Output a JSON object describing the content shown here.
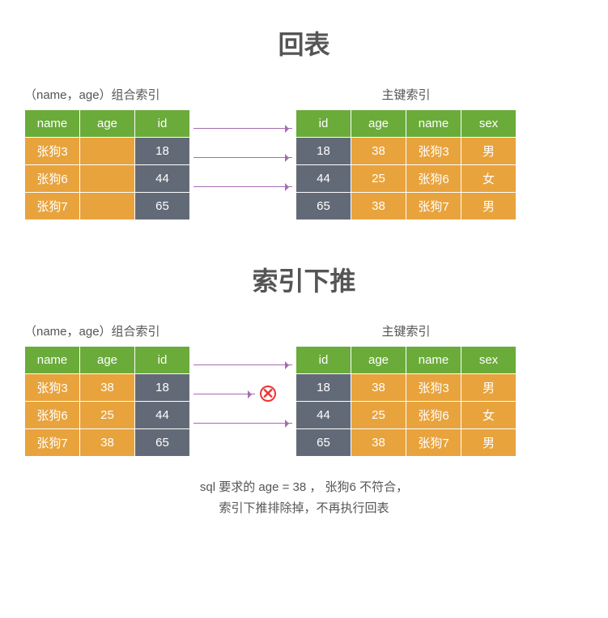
{
  "section1": {
    "title": "回表",
    "left_caption": "（name，age）组合索引",
    "right_caption": "主键索引",
    "left_headers": [
      "name",
      "age",
      "id"
    ],
    "left_rows": [
      {
        "name": "张狗3",
        "age": "",
        "id": "18"
      },
      {
        "name": "张狗6",
        "age": "",
        "id": "44"
      },
      {
        "name": "张狗7",
        "age": "",
        "id": "65"
      }
    ],
    "right_headers": [
      "id",
      "age",
      "name",
      "sex"
    ],
    "right_rows": [
      {
        "id": "18",
        "age": "38",
        "name": "张狗3",
        "sex": "男"
      },
      {
        "id": "44",
        "age": "25",
        "name": "张狗6",
        "sex": "女"
      },
      {
        "id": "65",
        "age": "38",
        "name": "张狗7",
        "sex": "男"
      }
    ]
  },
  "section2": {
    "title": "索引下推",
    "left_caption": "（name，age）组合索引",
    "right_caption": "主键索引",
    "left_headers": [
      "name",
      "age",
      "id"
    ],
    "left_rows": [
      {
        "name": "张狗3",
        "age": "38",
        "id": "18"
      },
      {
        "name": "张狗6",
        "age": "25",
        "id": "44"
      },
      {
        "name": "张狗7",
        "age": "38",
        "id": "65"
      }
    ],
    "right_headers": [
      "id",
      "age",
      "name",
      "sex"
    ],
    "right_rows": [
      {
        "id": "18",
        "age": "38",
        "name": "张狗3",
        "sex": "男"
      },
      {
        "id": "44",
        "age": "25",
        "name": "张狗6",
        "sex": "女"
      },
      {
        "id": "65",
        "age": "38",
        "name": "张狗7",
        "sex": "男"
      }
    ],
    "rejected_row_index": 1,
    "footer_line1": "sql 要求的 age = 38 ， 张狗6 不符合，",
    "footer_line2": "索引下推排除掉，不再执行回表"
  },
  "chart_data": [
    {
      "type": "table",
      "title": "回表 — (name, age) 组合索引",
      "columns": [
        "name",
        "age",
        "id"
      ],
      "rows": [
        [
          "张狗3",
          "",
          "18"
        ],
        [
          "张狗6",
          "",
          "44"
        ],
        [
          "张狗7",
          "",
          "65"
        ]
      ]
    },
    {
      "type": "table",
      "title": "回表 — 主键索引",
      "columns": [
        "id",
        "age",
        "name",
        "sex"
      ],
      "rows": [
        [
          "18",
          "38",
          "张狗3",
          "男"
        ],
        [
          "44",
          "25",
          "张狗6",
          "女"
        ],
        [
          "65",
          "38",
          "张狗7",
          "男"
        ]
      ]
    },
    {
      "type": "table",
      "title": "索引下推 — (name, age) 组合索引",
      "columns": [
        "name",
        "age",
        "id"
      ],
      "rows": [
        [
          "张狗3",
          "38",
          "18"
        ],
        [
          "张狗6",
          "25",
          "44"
        ],
        [
          "张狗7",
          "38",
          "65"
        ]
      ]
    },
    {
      "type": "table",
      "title": "索引下推 — 主键索引",
      "columns": [
        "id",
        "age",
        "name",
        "sex"
      ],
      "rows": [
        [
          "18",
          "38",
          "张狗3",
          "男"
        ],
        [
          "44",
          "25",
          "张狗6",
          "女"
        ],
        [
          "65",
          "38",
          "张狗7",
          "男"
        ]
      ]
    }
  ]
}
